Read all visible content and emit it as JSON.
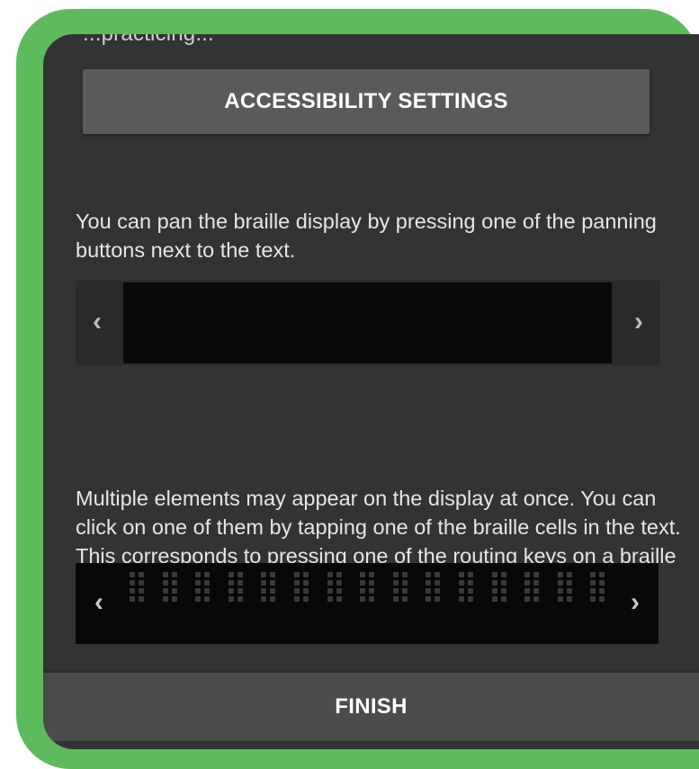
{
  "colors": {
    "frame_border": "#5dba5d",
    "screen_background": "#333333",
    "button_background": "#5a5a5a",
    "finish_background": "#4b4b4b",
    "braille_display_background": "#0a0a0a",
    "text": "#e6e6e6"
  },
  "header": {
    "partial_text": "...practicing..."
  },
  "accessibility_button": {
    "label": "ACCESSIBILITY SETTINGS"
  },
  "pan_section": {
    "description": "You can pan the braille display by pressing one of the panning buttons next to the text.",
    "left_icon": "chevron-left-icon",
    "left_glyph": "‹",
    "right_icon": "chevron-right-icon",
    "right_glyph": "›"
  },
  "routing_section": {
    "description": "Multiple elements may appear on the display at once. You can click on one of them by tapping one of the braille cells in the text. This corresponds to pressing one of the routing keys on a braille display.",
    "left_icon": "chevron-left-icon",
    "left_glyph": "‹",
    "right_icon": "chevron-right-icon",
    "right_glyph": "›",
    "braille_cell_count": 15
  },
  "finish_button": {
    "label": "FINISH"
  }
}
